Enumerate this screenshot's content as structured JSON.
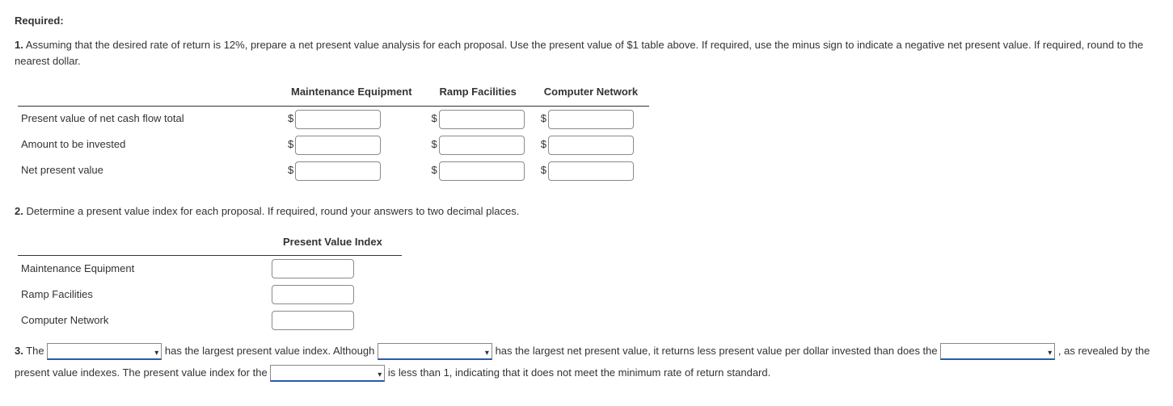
{
  "heading": "Required:",
  "q1": {
    "num": "1.",
    "text": "Assuming that the desired rate of return is 12%, prepare a net present value analysis for each proposal. Use the present value of $1 table above. If required, use the minus sign to indicate a negative net present value. If required, round to the nearest dollar.",
    "cols": [
      "Maintenance Equipment",
      "Ramp Facilities",
      "Computer Network"
    ],
    "rows": [
      "Present value of net cash flow total",
      "Amount to be invested",
      "Net present value"
    ],
    "currency": "$"
  },
  "q2": {
    "num": "2.",
    "text": "Determine a present value index for each proposal. If required, round your answers to two decimal places.",
    "col": "Present Value Index",
    "rows": [
      "Maintenance Equipment",
      "Ramp Facilities",
      "Computer Network"
    ]
  },
  "q3": {
    "num": "3.",
    "parts": {
      "p0": "The ",
      "p1": " has the largest present value index. Although ",
      "p2": " has the largest net present value, it returns less present value per dollar invested than does the ",
      "p3": " , as revealed by the present value indexes. The present value index for the ",
      "p4": " is less than 1, indicating that it does not meet the minimum rate of return standard."
    }
  }
}
